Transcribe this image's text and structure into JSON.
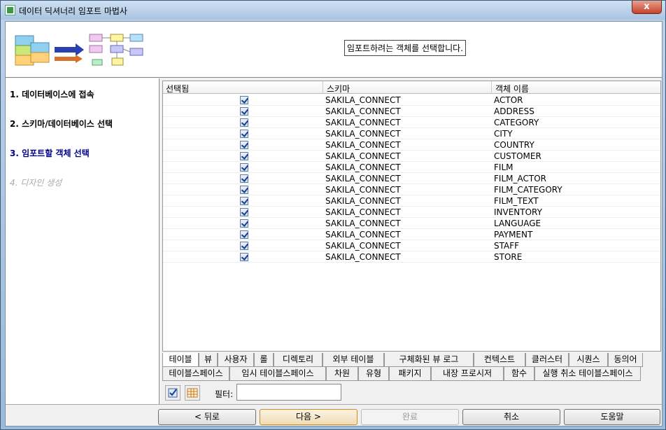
{
  "window": {
    "title": "데이터 딕셔너리 임포트 마법사",
    "close_label": "x"
  },
  "header": {
    "instruction": "임포트하려는 객체를 선택합니다."
  },
  "steps": [
    {
      "label": "1. 데이터베이스에 접속",
      "state": "done"
    },
    {
      "label": "2. 스키마/데이터베이스 선택",
      "state": "done"
    },
    {
      "label": "3. 임포트할 객체 선택",
      "state": "current"
    },
    {
      "label": "4. 디자인 생성",
      "state": "future"
    }
  ],
  "grid": {
    "columns": [
      "선택됨",
      "스키마",
      "객체 이름"
    ],
    "rows": [
      {
        "selected": true,
        "schema": "SAKILA_CONNECT",
        "name": "ACTOR"
      },
      {
        "selected": true,
        "schema": "SAKILA_CONNECT",
        "name": "ADDRESS"
      },
      {
        "selected": true,
        "schema": "SAKILA_CONNECT",
        "name": "CATEGORY"
      },
      {
        "selected": true,
        "schema": "SAKILA_CONNECT",
        "name": "CITY"
      },
      {
        "selected": true,
        "schema": "SAKILA_CONNECT",
        "name": "COUNTRY"
      },
      {
        "selected": true,
        "schema": "SAKILA_CONNECT",
        "name": "CUSTOMER"
      },
      {
        "selected": true,
        "schema": "SAKILA_CONNECT",
        "name": "FILM"
      },
      {
        "selected": true,
        "schema": "SAKILA_CONNECT",
        "name": "FILM_ACTOR"
      },
      {
        "selected": true,
        "schema": "SAKILA_CONNECT",
        "name": "FILM_CATEGORY"
      },
      {
        "selected": true,
        "schema": "SAKILA_CONNECT",
        "name": "FILM_TEXT"
      },
      {
        "selected": true,
        "schema": "SAKILA_CONNECT",
        "name": "INVENTORY"
      },
      {
        "selected": true,
        "schema": "SAKILA_CONNECT",
        "name": "LANGUAGE"
      },
      {
        "selected": true,
        "schema": "SAKILA_CONNECT",
        "name": "PAYMENT"
      },
      {
        "selected": true,
        "schema": "SAKILA_CONNECT",
        "name": "STAFF"
      },
      {
        "selected": true,
        "schema": "SAKILA_CONNECT",
        "name": "STORE"
      }
    ]
  },
  "tabs_row1": [
    "테이블",
    "뷰",
    "사용자",
    "롤",
    "디렉토리",
    "외부 테이블",
    "구체화된 뷰 로그",
    "컨텍스트",
    "클러스터",
    "시퀀스",
    "동의어"
  ],
  "tabs_row2": [
    "테이블스페이스",
    "임시 테이블스페이스",
    "차원",
    "유형",
    "패키지",
    "내장 프로시저",
    "함수",
    "실행 취소 테이블스페이스"
  ],
  "active_tab": "테이블",
  "filter": {
    "label": "필터:",
    "value": "",
    "check_all_icon": "check-all-icon",
    "grid_icon": "table-grid-icon"
  },
  "buttons": {
    "back": "< 뒤로",
    "next": "다음 >",
    "finish": "완료",
    "cancel": "취소",
    "help": "도움말"
  }
}
